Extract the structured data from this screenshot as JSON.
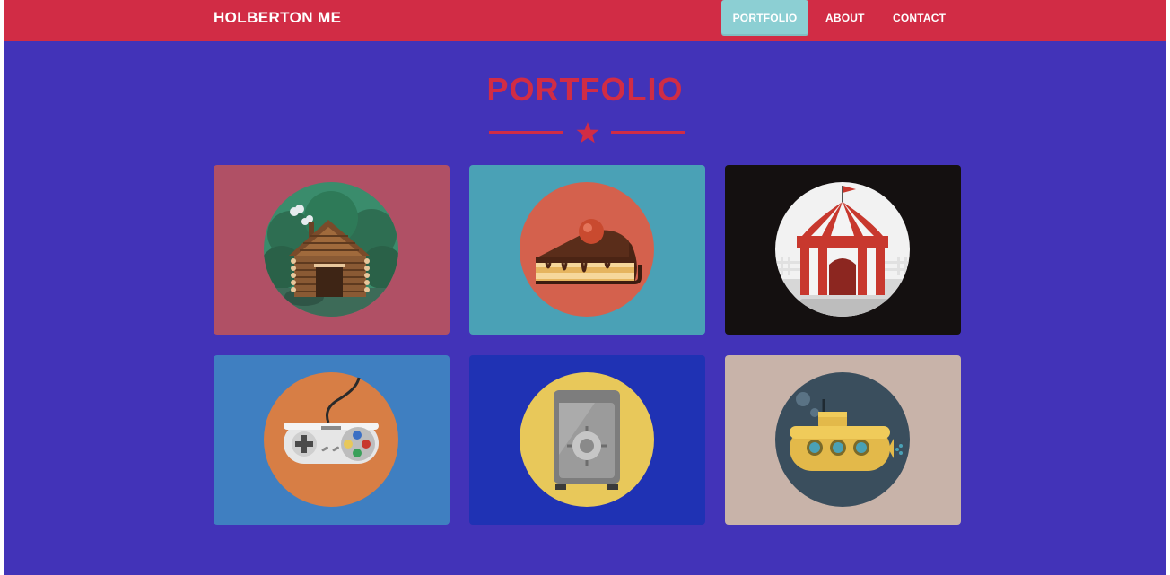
{
  "nav": {
    "brand": "HOLBERTON ME",
    "items": [
      {
        "label": "PORTFOLIO",
        "active": true
      },
      {
        "label": "ABOUT",
        "active": false
      },
      {
        "label": "CONTACT",
        "active": false
      }
    ]
  },
  "section": {
    "title": "PORTFOLIO"
  },
  "colors": {
    "page_bg": "#4233b8",
    "accent": "#d12c45",
    "nav_active": "#8ccfd3"
  },
  "portfolio": [
    {
      "icon": "log-cabin-icon",
      "bg": "#b05065",
      "circle": "#3a8c6c"
    },
    {
      "icon": "cake-slice-icon",
      "bg": "#4aa1b6",
      "circle": "#d4614d"
    },
    {
      "icon": "circus-tent-icon",
      "bg": "#141010",
      "circle": "#f2f2f2"
    },
    {
      "icon": "game-controller-icon",
      "bg": "#3f7fc1",
      "circle": "#d77e45"
    },
    {
      "icon": "safe-icon",
      "bg": "#1f32b4",
      "circle": "#e8c85a"
    },
    {
      "icon": "submarine-icon",
      "bg": "#c8b3a9",
      "circle": "#3a4e5d"
    }
  ]
}
